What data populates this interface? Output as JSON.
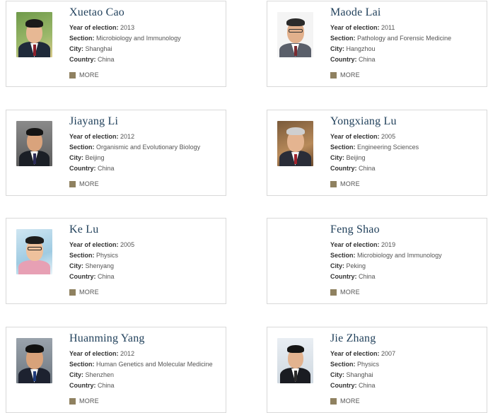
{
  "labels": {
    "year": "Year of election:",
    "section": "Section:",
    "city": "City:",
    "country": "Country:",
    "more": "MORE"
  },
  "colors": {
    "name": "#1f3f5a",
    "more_square": "#8f8160",
    "card_border": "#d9d9d9"
  },
  "members": [
    {
      "name": "Xuetao Cao",
      "year": "2013",
      "section": "Microbiology and Immunology",
      "city": "Shanghai",
      "country": "China",
      "photo": "portrait-photo"
    },
    {
      "name": "Maode Lai",
      "year": "2011",
      "section": "Pathology and Forensic Medicine",
      "city": "Hangzhou",
      "country": "China",
      "photo": "portrait-photo"
    },
    {
      "name": "Jiayang Li",
      "year": "2012",
      "section": "Organismic and Evolutionary Biology",
      "city": "Beijing",
      "country": "China",
      "photo": "portrait-photo"
    },
    {
      "name": "Yongxiang Lu",
      "year": "2005",
      "section": "Engineering Sciences",
      "city": "Beijing",
      "country": "China",
      "photo": "portrait-photo"
    },
    {
      "name": "Ke Lu",
      "year": "2005",
      "section": "Physics",
      "city": "Shenyang",
      "country": "China",
      "photo": "portrait-photo"
    },
    {
      "name": "Feng Shao",
      "year": "2019",
      "section": "Microbiology and Immunology",
      "city": "Peking",
      "country": "China",
      "photo": ""
    },
    {
      "name": "Huanming Yang",
      "year": "2012",
      "section": "Human Genetics and Molecular Medicine",
      "city": "Shenzhen",
      "country": "China",
      "photo": "portrait-photo"
    },
    {
      "name": "Jie Zhang",
      "year": "2007",
      "section": "Physics",
      "city": "Shanghai",
      "country": "China",
      "photo": "portrait-photo"
    }
  ]
}
